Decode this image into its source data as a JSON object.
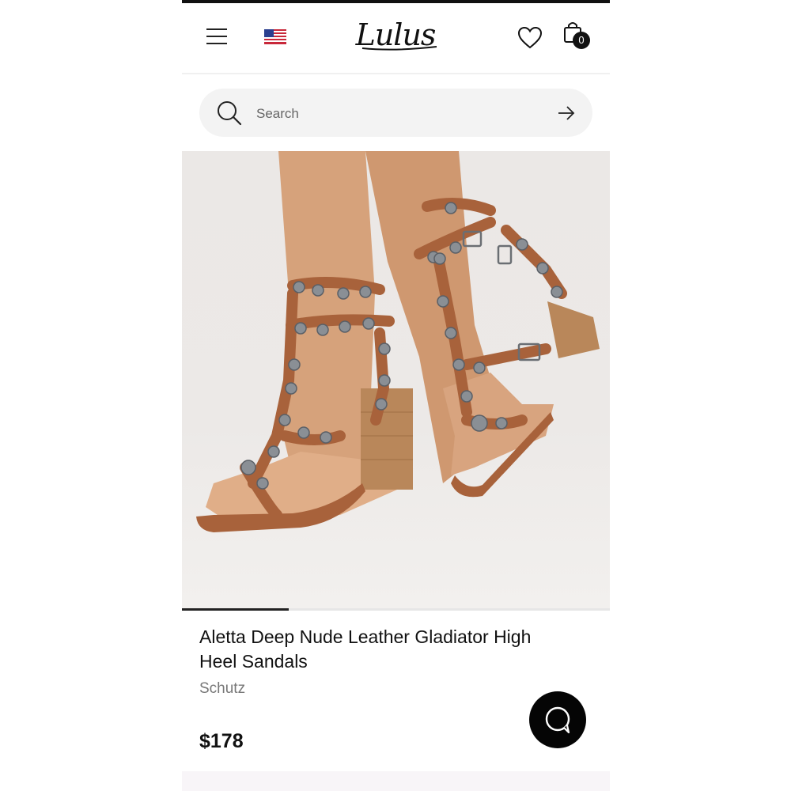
{
  "header": {
    "logo_text": "Lulus",
    "menu_icon": "hamburger-menu-icon",
    "flag_icon": "us-flag-icon",
    "wishlist_icon": "heart-icon",
    "bag_icon": "shopping-bag-icon",
    "bag_count": "0"
  },
  "search": {
    "placeholder": "Search",
    "icon": "search-icon",
    "submit_icon": "arrow-right-icon"
  },
  "product": {
    "image_alt": "brown-studded-gladiator-heel-sandals",
    "carousel_progress": 0.25,
    "title": "Aletta Deep Nude Leather Gladiator High Heel Sandals",
    "brand": "Schutz",
    "price": "$178"
  },
  "chat": {
    "icon": "chat-bubble-icon"
  },
  "colors": {
    "leather": "#a8623b",
    "heel": "#b9875a",
    "text": "#111111",
    "muted": "#777777"
  }
}
